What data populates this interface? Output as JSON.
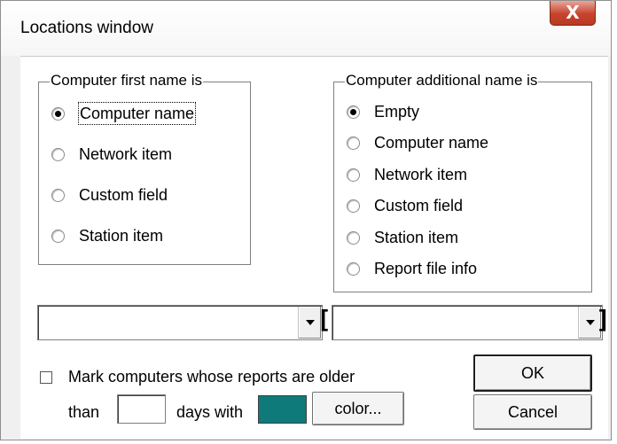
{
  "window": {
    "title": "Locations window",
    "close_glyph": "X"
  },
  "first_name_group": {
    "title": "Computer first name is",
    "options": [
      "Computer name",
      "Network item",
      "Custom field",
      "Station item"
    ],
    "selected": "Computer name"
  },
  "additional_name_group": {
    "title": "Computer additional name is",
    "options": [
      "Empty",
      "Computer name",
      "Network item",
      "Custom field",
      "Station item",
      "Report file info"
    ],
    "selected": "Empty"
  },
  "combos": {
    "first_value": "",
    "additional_value": ""
  },
  "brackets": {
    "open": "[",
    "close": "]"
  },
  "mark_old": {
    "checked": false,
    "label_line1": "Mark computers whose reports are older",
    "label_than": "than",
    "days_value": "",
    "label_days_with": "days with",
    "swatch_color": "#0e7a7a",
    "color_button": "color..."
  },
  "buttons": {
    "ok": "OK",
    "cancel": "Cancel"
  },
  "icons": {
    "close": "close-icon",
    "dropdown": "chevron-down-icon",
    "radio": "radio-icon",
    "checkbox": "checkbox-icon"
  }
}
